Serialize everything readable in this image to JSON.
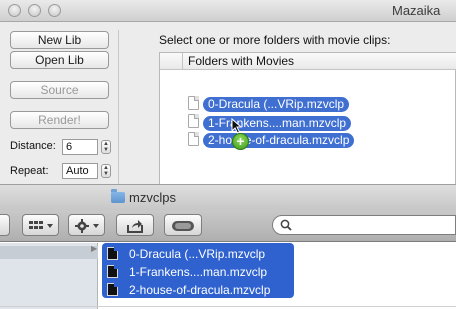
{
  "app": {
    "title": "Mazaika",
    "buttons": {
      "new_lib": "New Lib",
      "open_lib": "Open Lib",
      "source": "Source",
      "render": "Render!"
    },
    "distance": {
      "label": "Distance:",
      "value": "6"
    },
    "repeat": {
      "label": "Repeat:",
      "value": "Auto"
    },
    "instructions": "Select one or more folders with movie clips:",
    "folders_header": "Folders with Movies",
    "dragged_items": [
      "0-Dracula (...VRip.mzvclp",
      "1-Frankens....man.mzvclp",
      "2-house-of-dracula.mzvclp"
    ],
    "copy_badge": "+"
  },
  "finder": {
    "title": "mzvclps",
    "toolbar": {
      "view_icon": "grid-icon",
      "action_icon": "gear-icon",
      "share_icon": "share-icon",
      "toggle_icon": "toggle-icon",
      "search_icon": "search-icon",
      "search_placeholder": ""
    },
    "disclosure": "▶",
    "files": [
      "0-Dracula (...VRip.mzvclp",
      "1-Frankens....man.mzvclp",
      "2-house-of-dracula.mzvclp"
    ]
  },
  "colors": {
    "selection": "#3f6fd1",
    "finder_selection": "#2f62cf",
    "window_bg": "#ececec",
    "badge_green": "#3e9a1e"
  }
}
